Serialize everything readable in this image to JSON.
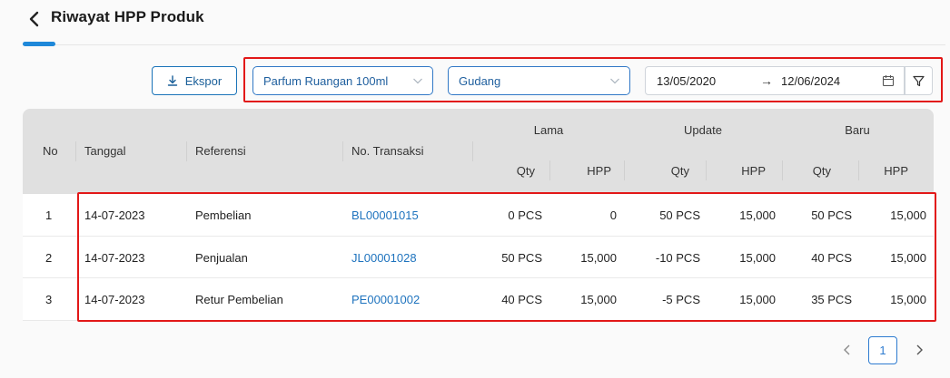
{
  "header": {
    "title": "Riwayat HPP Produk"
  },
  "toolbar": {
    "export_label": "Ekspor",
    "product_select": "Parfum Ruangan 100ml",
    "warehouse_select": "Gudang",
    "date_start": "13/05/2020",
    "date_arrow": "→",
    "date_end": "12/06/2024"
  },
  "table": {
    "columns": {
      "no": "No",
      "tanggal": "Tanggal",
      "referensi": "Referensi",
      "no_transaksi": "No. Transaksi",
      "lama": "Lama",
      "update": "Update",
      "baru": "Baru",
      "qty": "Qty",
      "hpp": "HPP"
    },
    "rows": [
      {
        "no": "1",
        "tanggal": "14-07-2023",
        "referensi": "Pembelian",
        "no_transaksi": "BL00001015",
        "lama_qty": "0 PCS",
        "lama_hpp": "0",
        "update_qty": "50 PCS",
        "update_hpp": "15,000",
        "baru_qty": "50 PCS",
        "baru_hpp": "15,000"
      },
      {
        "no": "2",
        "tanggal": "14-07-2023",
        "referensi": "Penjualan",
        "no_transaksi": "JL00001028",
        "lama_qty": "50 PCS",
        "lama_hpp": "15,000",
        "update_qty": "-10 PCS",
        "update_hpp": "15,000",
        "baru_qty": "40 PCS",
        "baru_hpp": "15,000"
      },
      {
        "no": "3",
        "tanggal": "14-07-2023",
        "referensi": "Retur Pembelian",
        "no_transaksi": "PE00001002",
        "lama_qty": "40 PCS",
        "lama_hpp": "15,000",
        "update_qty": "-5 PCS",
        "update_hpp": "15,000",
        "baru_qty": "35 PCS",
        "baru_hpp": "15,000"
      }
    ]
  },
  "pagination": {
    "current_page": "1"
  },
  "colors": {
    "accent": "#1e88d9",
    "link": "#1e73be",
    "highlight": "#e21818",
    "header_bg": "#e0e0e0"
  }
}
